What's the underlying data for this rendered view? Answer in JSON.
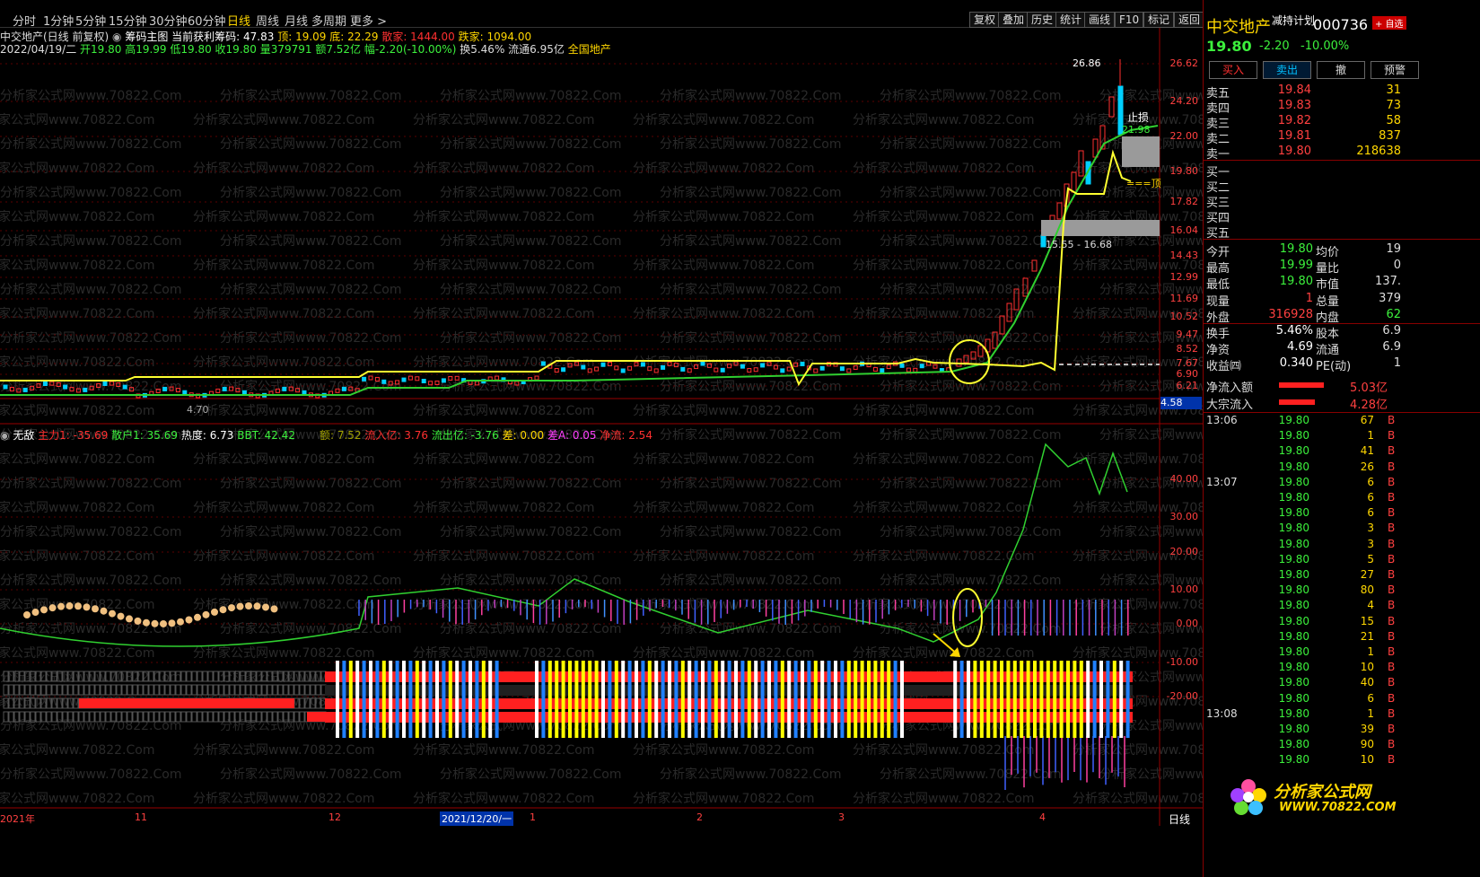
{
  "menu": {
    "tabs": [
      "分时",
      "1分钟",
      "5分钟",
      "15分钟",
      "30分钟",
      "60分钟",
      "日线",
      "周线",
      "月线",
      "多周期",
      "更多 >"
    ],
    "active": "日线",
    "tools": [
      "复权",
      "叠加",
      "历史",
      "统计",
      "画线",
      "F10",
      "标记",
      "返回"
    ]
  },
  "header": {
    "line1_a": "中交地产(日线 前复权)",
    "line1_b": "筹码主图",
    "line1_c": "当前获利筹码: 47.83",
    "line1_d": "顶: 19.09",
    "line1_e": "底: 22.29",
    "line1_f": "散家: 1444.00",
    "line1_g": "跌家: 1094.00",
    "line2_a": "2022/04/19/二",
    "line2_b": "开19.80 高19.99 低19.80 收19.80 量379791 额7.52亿",
    "line2_c": "幅-2.20(-10.00%)",
    "line2_d": "换5.46% 流通6.95亿",
    "line2_e": "全国地产"
  },
  "price_axis": [
    "26.62",
    "24.20",
    "22.00",
    "19.80",
    "17.82",
    "16.04",
    "14.43",
    "12.99",
    "11.69",
    "10.52",
    "9.47",
    "8.52",
    "7.67",
    "6.90",
    "6.21"
  ],
  "current_price_tag": "4.58",
  "chart_annotations": {
    "peak": "26.86",
    "stop": "止损",
    "stop_val": "21.98",
    "top": "===顶",
    "zone": "15.55 - 16.68",
    "low": "4.70"
  },
  "indicator": {
    "name": "无敌",
    "zhuli": "主力1: -35.69",
    "sanhu": "散户1: 35.69",
    "redu": "热度: 6.73",
    "bbt": "BBT: 42.42",
    "e": "额: 7.52",
    "liuru": "流入亿: 3.76",
    "liuchu": "流出亿: -3.76",
    "cha": "差: 0.00",
    "chaA": "差A: 0.05",
    "jingliu": "净流: 2.54",
    "axis": [
      "40.00",
      "30.00",
      "20.00",
      "10.00",
      "0.00",
      "-10.00",
      "-20.00"
    ]
  },
  "date_axis": [
    "2021年",
    "11",
    "12",
    "2021/12/20/一",
    "1",
    "2",
    "3",
    "4"
  ],
  "period_label": "日线",
  "watermark": "分析家公式网www.70822.Com",
  "right": {
    "name": "中交地产",
    "plan": "减持计划",
    "code": "000736",
    "price": "19.80",
    "change": "-2.20",
    "pct": "-10.00%",
    "badge": "+ 自选",
    "buttons": [
      "买入",
      "卖出",
      "撤",
      "预警"
    ],
    "sells": [
      {
        "label": "卖五",
        "price": "19.84",
        "vol": "31"
      },
      {
        "label": "卖四",
        "price": "19.83",
        "vol": "73"
      },
      {
        "label": "卖三",
        "price": "19.82",
        "vol": "58"
      },
      {
        "label": "卖二",
        "price": "19.81",
        "vol": "837"
      },
      {
        "label": "卖一",
        "price": "19.80",
        "vol": "218638"
      }
    ],
    "buys": [
      "买一",
      "买二",
      "买三",
      "买四",
      "买五"
    ],
    "stats": [
      {
        "l": "今开",
        "v": "19.80",
        "l2": "均价",
        "v2": "19"
      },
      {
        "l": "最高",
        "v": "19.99",
        "l2": "量比",
        "v2": "0"
      },
      {
        "l": "最低",
        "v": "19.80",
        "l2": "市值",
        "v2": "137."
      },
      {
        "l": "现量",
        "v": "1",
        "l2": "总量",
        "v2": "379"
      },
      {
        "l": "外盘",
        "v": "316928",
        "l2": "内盘",
        "v2": "62"
      },
      {
        "l": "换手",
        "v": "5.46%",
        "l2": "股本",
        "v2": "6.9"
      },
      {
        "l": "净资",
        "v": "4.69",
        "l2": "流通",
        "v2": "6.9"
      },
      {
        "l": "收益㈣",
        "v": "0.340",
        "l2": "PE(动)",
        "v2": "1"
      }
    ],
    "flows": [
      {
        "l": "净流入额",
        "v": "5.03亿"
      },
      {
        "l": "大宗流入",
        "v": "4.28亿"
      }
    ],
    "ticks": [
      {
        "t": "13:06",
        "p": "19.80",
        "v": "67",
        "b": "B"
      },
      {
        "t": "",
        "p": "19.80",
        "v": "1",
        "b": "B"
      },
      {
        "t": "",
        "p": "19.80",
        "v": "41",
        "b": "B"
      },
      {
        "t": "",
        "p": "19.80",
        "v": "26",
        "b": "B"
      },
      {
        "t": "13:07",
        "p": "19.80",
        "v": "6",
        "b": "B"
      },
      {
        "t": "",
        "p": "19.80",
        "v": "6",
        "b": "B"
      },
      {
        "t": "",
        "p": "19.80",
        "v": "6",
        "b": "B"
      },
      {
        "t": "",
        "p": "19.80",
        "v": "3",
        "b": "B"
      },
      {
        "t": "",
        "p": "19.80",
        "v": "3",
        "b": "B"
      },
      {
        "t": "",
        "p": "19.80",
        "v": "5",
        "b": "B"
      },
      {
        "t": "",
        "p": "19.80",
        "v": "27",
        "b": "B"
      },
      {
        "t": "",
        "p": "19.80",
        "v": "80",
        "b": "B"
      },
      {
        "t": "",
        "p": "19.80",
        "v": "4",
        "b": "B"
      },
      {
        "t": "",
        "p": "19.80",
        "v": "15",
        "b": "B"
      },
      {
        "t": "",
        "p": "19.80",
        "v": "21",
        "b": "B"
      },
      {
        "t": "",
        "p": "19.80",
        "v": "1",
        "b": "B"
      },
      {
        "t": "",
        "p": "19.80",
        "v": "10",
        "b": "B"
      },
      {
        "t": "",
        "p": "19.80",
        "v": "40",
        "b": "B"
      },
      {
        "t": "",
        "p": "19.80",
        "v": "6",
        "b": "B"
      },
      {
        "t": "13:08",
        "p": "19.80",
        "v": "1",
        "b": "B"
      },
      {
        "t": "",
        "p": "19.80",
        "v": "39",
        "b": "B"
      },
      {
        "t": "",
        "p": "19.80",
        "v": "90",
        "b": "B"
      },
      {
        "t": "",
        "p": "19.80",
        "v": "10",
        "b": "B"
      }
    ],
    "logo_cn": "分析家公式网",
    "logo_url": "WWW.70822.COM"
  }
}
